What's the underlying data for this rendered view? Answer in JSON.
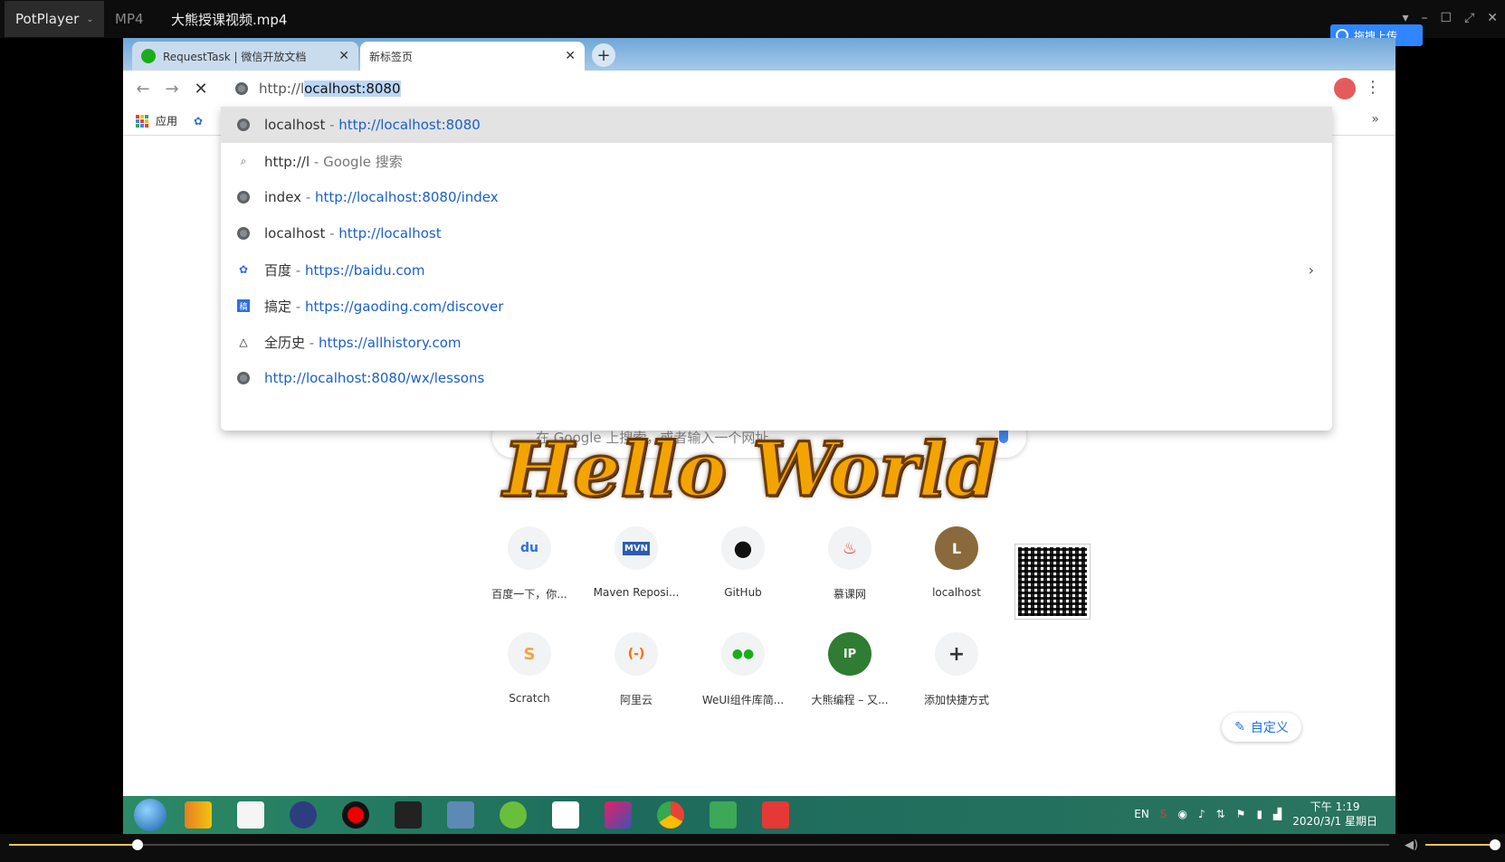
{
  "player": {
    "brand": "PotPlayer",
    "format": "MP4",
    "filename": "大熊授课视频.mp4",
    "upload_badge": "拖拽上传",
    "progress_fraction": 0.093,
    "volume_fraction": 1.0
  },
  "browser": {
    "tabs": [
      {
        "label": "RequestTask | 微信开放文档"
      },
      {
        "label": "新标签页"
      }
    ],
    "omnibox": {
      "prefix": "http://l",
      "selected": "ocalhost:8080"
    },
    "bookmarks": {
      "apps_label": "应用",
      "more": "»"
    },
    "suggestions": [
      {
        "title": "localhost",
        "sep": " - ",
        "url": "http://localhost:8080",
        "icon": "globe-icon"
      },
      {
        "title": "http://l",
        "sep": " - ",
        "url": "Google 搜索",
        "icon": "search-icon"
      },
      {
        "title": "index",
        "sep": " - ",
        "url": "http://localhost:8080/index",
        "icon": "globe-icon"
      },
      {
        "title": "localhost",
        "sep": " - ",
        "url": "http://localhost",
        "icon": "globe-icon"
      },
      {
        "title": "百度",
        "sep": " - ",
        "url": "https://baidu.com",
        "icon": "baidu-paw-icon"
      },
      {
        "title": "搞定",
        "sep": " - ",
        "url": "https://gaoding.com/discover",
        "icon": "gaoding-icon"
      },
      {
        "title": "全历史",
        "sep": " - ",
        "url": "https://allhistory.com",
        "icon": "allhistory-icon"
      },
      {
        "title": "",
        "sep": "",
        "url": "http://localhost:8080/wx/lessons",
        "icon": "globe-icon"
      }
    ]
  },
  "ntp": {
    "search_placeholder": "在 Google 上搜索，或者输入一个网址",
    "overlay_text": "Hello World",
    "tiles": [
      {
        "label": "百度一下，你...",
        "glyph": "du",
        "color": "#2f6fde"
      },
      {
        "label": "Maven Reposi...",
        "glyph": "MVN",
        "color": "#2a5db0"
      },
      {
        "label": "GitHub",
        "glyph": "●",
        "color": "#111111"
      },
      {
        "label": "慕课网",
        "glyph": "♨",
        "color": "#e53935"
      },
      {
        "label": "localhost",
        "glyph": "L",
        "color": "#ffffff"
      },
      {
        "label": "Scratch",
        "glyph": "S",
        "color": "#f4a340"
      },
      {
        "label": "阿里云",
        "glyph": "(-)",
        "color": "#ff6a00"
      },
      {
        "label": "WeUI组件库简...",
        "glyph": "●●",
        "color": "#1aad19"
      },
      {
        "label": "大熊编程 – 又...",
        "glyph": "IP",
        "color": "#ffffff"
      },
      {
        "label": "添加快捷方式",
        "glyph": "+",
        "color": "#333333"
      }
    ],
    "customize_label": "自定义"
  },
  "taskbar": {
    "lang": "EN",
    "time": "下午 1:19",
    "date": "2020/3/1 星期日"
  }
}
